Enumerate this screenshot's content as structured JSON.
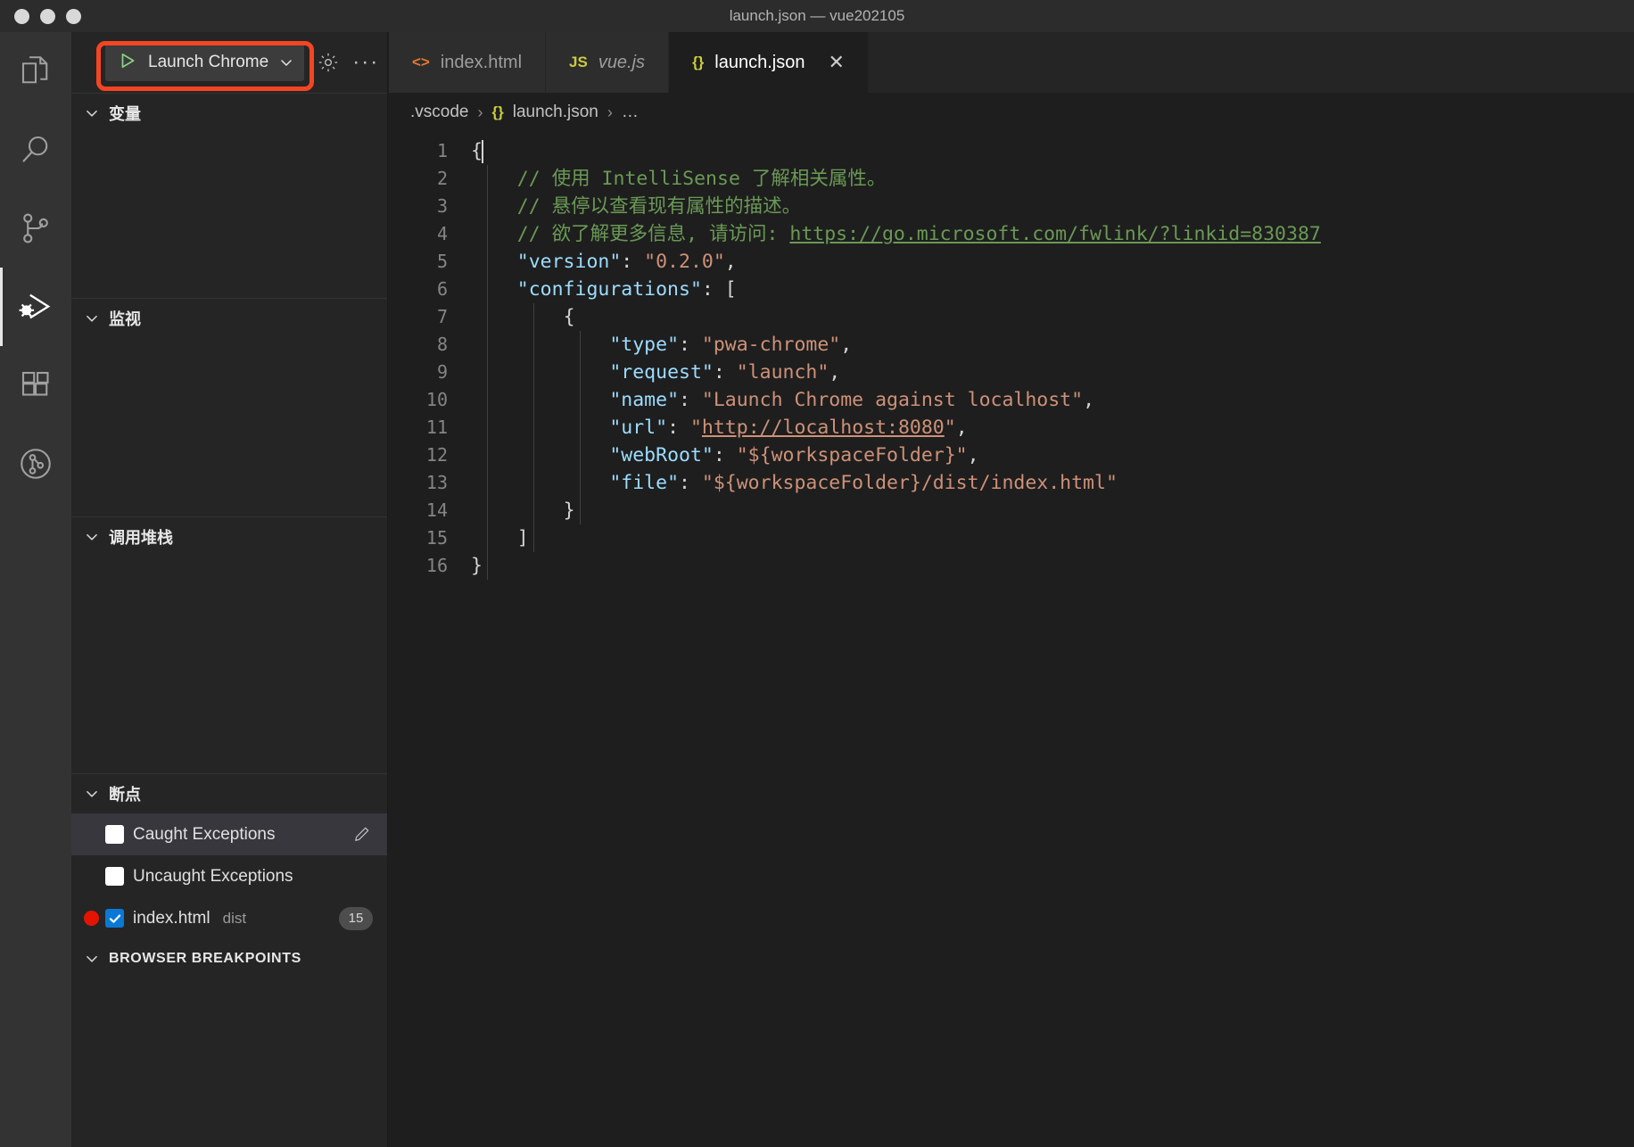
{
  "window": {
    "title": "launch.json — vue202105",
    "traffic_lights": [
      "close",
      "minimize",
      "zoom"
    ]
  },
  "activity_bar": {
    "items": [
      {
        "name": "explorer",
        "icon": "files-icon",
        "active": false
      },
      {
        "name": "search",
        "icon": "search-icon",
        "active": false
      },
      {
        "name": "source-control",
        "icon": "source-control-icon",
        "active": false
      },
      {
        "name": "run-and-debug",
        "icon": "debug-icon",
        "active": true
      },
      {
        "name": "extensions",
        "icon": "extensions-icon",
        "active": false
      },
      {
        "name": "testing",
        "icon": "beaker-icon",
        "active": false
      }
    ]
  },
  "sidebar": {
    "toolbar": {
      "launch_config": "Launch Chrome",
      "start_icon": "play-icon",
      "dropdown_icon": "chevron-down-icon",
      "settings_icon": "gear-icon",
      "more_label": "···",
      "highlight_color": "#f44522"
    },
    "sections": [
      {
        "title": "变量",
        "collapsed": false
      },
      {
        "title": "监视",
        "collapsed": false
      },
      {
        "title": "调用堆栈",
        "collapsed": false
      },
      {
        "title": "断点",
        "collapsed": false
      },
      {
        "title": "BROWSER BREAKPOINTS",
        "collapsed": false
      }
    ],
    "breakpoints": [
      {
        "label": "Caught Exceptions",
        "checked": false,
        "has_dot": false,
        "sub": "",
        "badge": "",
        "selected": true,
        "edit_icon": "pencil-icon"
      },
      {
        "label": "Uncaught Exceptions",
        "checked": false,
        "has_dot": false,
        "sub": "",
        "badge": "",
        "selected": false,
        "edit_icon": ""
      },
      {
        "label": "index.html",
        "checked": true,
        "has_dot": true,
        "sub": "dist",
        "badge": "15",
        "selected": false,
        "edit_icon": ""
      }
    ]
  },
  "editor": {
    "tabs": [
      {
        "label": "index.html",
        "icon": "<>",
        "icon_kind": "html",
        "active": false,
        "italic": false,
        "closable": false
      },
      {
        "label": "vue.js",
        "icon": "JS",
        "icon_kind": "js",
        "active": false,
        "italic": true,
        "closable": false
      },
      {
        "label": "launch.json",
        "icon": "{}",
        "icon_kind": "json",
        "active": true,
        "italic": false,
        "closable": true
      }
    ],
    "close_glyph": "✕",
    "breadcrumbs": {
      "folder": ".vscode",
      "sep": "›",
      "file_icon": "{}",
      "file": "launch.json",
      "tail": "…"
    },
    "code": {
      "language": "json",
      "lines": [
        {
          "n": 1,
          "indent": 0,
          "tokens": [
            {
              "t": "{",
              "c": "p"
            }
          ],
          "cursor": true
        },
        {
          "n": 2,
          "indent": 1,
          "tokens": [
            {
              "t": "// 使用 IntelliSense 了解相关属性。",
              "c": "c"
            }
          ]
        },
        {
          "n": 3,
          "indent": 1,
          "tokens": [
            {
              "t": "// 悬停以查看现有属性的描述。",
              "c": "c"
            }
          ]
        },
        {
          "n": 4,
          "indent": 1,
          "tokens": [
            {
              "t": "// 欲了解更多信息, 请访问: ",
              "c": "c"
            },
            {
              "t": "https://go.microsoft.com/fwlink/?linkid=830387",
              "c": "link"
            }
          ]
        },
        {
          "n": 5,
          "indent": 1,
          "tokens": [
            {
              "t": "\"version\"",
              "c": "key"
            },
            {
              "t": ": ",
              "c": "p"
            },
            {
              "t": "\"0.2.0\"",
              "c": "str"
            },
            {
              "t": ",",
              "c": "p"
            }
          ]
        },
        {
          "n": 6,
          "indent": 1,
          "tokens": [
            {
              "t": "\"configurations\"",
              "c": "key"
            },
            {
              "t": ": [",
              "c": "p"
            }
          ]
        },
        {
          "n": 7,
          "indent": 2,
          "tokens": [
            {
              "t": "{",
              "c": "p"
            }
          ]
        },
        {
          "n": 8,
          "indent": 3,
          "tokens": [
            {
              "t": "\"type\"",
              "c": "key"
            },
            {
              "t": ": ",
              "c": "p"
            },
            {
              "t": "\"pwa-chrome\"",
              "c": "str"
            },
            {
              "t": ",",
              "c": "p"
            }
          ]
        },
        {
          "n": 9,
          "indent": 3,
          "tokens": [
            {
              "t": "\"request\"",
              "c": "key"
            },
            {
              "t": ": ",
              "c": "p"
            },
            {
              "t": "\"launch\"",
              "c": "str"
            },
            {
              "t": ",",
              "c": "p"
            }
          ]
        },
        {
          "n": 10,
          "indent": 3,
          "tokens": [
            {
              "t": "\"name\"",
              "c": "key"
            },
            {
              "t": ": ",
              "c": "p"
            },
            {
              "t": "\"Launch Chrome against localhost\"",
              "c": "str"
            },
            {
              "t": ",",
              "c": "p"
            }
          ]
        },
        {
          "n": 11,
          "indent": 3,
          "tokens": [
            {
              "t": "\"url\"",
              "c": "key"
            },
            {
              "t": ": ",
              "c": "p"
            },
            {
              "t": "\"",
              "c": "str"
            },
            {
              "t": "http://localhost:8080",
              "c": "strlink"
            },
            {
              "t": "\"",
              "c": "str"
            },
            {
              "t": ",",
              "c": "p"
            }
          ]
        },
        {
          "n": 12,
          "indent": 3,
          "tokens": [
            {
              "t": "\"webRoot\"",
              "c": "key"
            },
            {
              "t": ": ",
              "c": "p"
            },
            {
              "t": "\"${workspaceFolder}\"",
              "c": "str"
            },
            {
              "t": ",",
              "c": "p"
            }
          ]
        },
        {
          "n": 13,
          "indent": 3,
          "tokens": [
            {
              "t": "\"file\"",
              "c": "key"
            },
            {
              "t": ": ",
              "c": "p"
            },
            {
              "t": "\"${workspaceFolder}/dist/index.html\"",
              "c": "str"
            }
          ]
        },
        {
          "n": 14,
          "indent": 2,
          "tokens": [
            {
              "t": "}",
              "c": "p"
            }
          ]
        },
        {
          "n": 15,
          "indent": 1,
          "tokens": [
            {
              "t": "]",
              "c": "p"
            }
          ]
        },
        {
          "n": 16,
          "indent": 0,
          "tokens": [
            {
              "t": "}",
              "c": "p"
            }
          ]
        }
      ]
    }
  },
  "colors": {
    "background": "#1e1e1e",
    "sidebar": "#252526",
    "activitybar": "#333333",
    "titlebar": "#2c2c2c",
    "accent_highlight": "#f44522",
    "breakpoint_red": "#e51400",
    "checkbox_blue": "#0a79d6",
    "play_green": "#89d185"
  }
}
